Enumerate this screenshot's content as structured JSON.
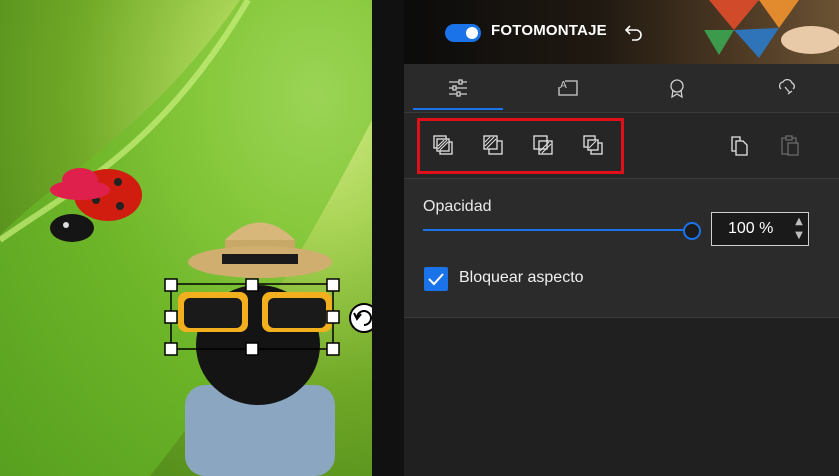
{
  "header": {
    "title": "FOTOMONTAJE",
    "toggle_on": true,
    "icons": [
      "toggle-switch",
      "undo-icon",
      "tangram-decoration"
    ]
  },
  "tabs": [
    {
      "name": "adjust",
      "icon": "sliders-icon",
      "active": true
    },
    {
      "name": "text",
      "icon": "text-frame-icon",
      "active": false
    },
    {
      "name": "stickers",
      "icon": "badge-icon",
      "active": false
    },
    {
      "name": "effects",
      "icon": "cloud-brush-icon",
      "active": false
    }
  ],
  "arrange": {
    "buttons": [
      "bring-to-front-icon",
      "bring-forward-icon",
      "send-backward-icon",
      "send-to-back-icon"
    ],
    "copy_icon": "copy-icon",
    "paste_icon": "paste-icon"
  },
  "opacity": {
    "label": "Opacidad",
    "value_text": "100 %",
    "level_percent": 100
  },
  "aspect": {
    "label": "Bloquear aspecto",
    "checked": true
  },
  "colors": {
    "accent": "#1a73e8",
    "highlight": "#e0101a",
    "panel_bg": "#202020"
  }
}
